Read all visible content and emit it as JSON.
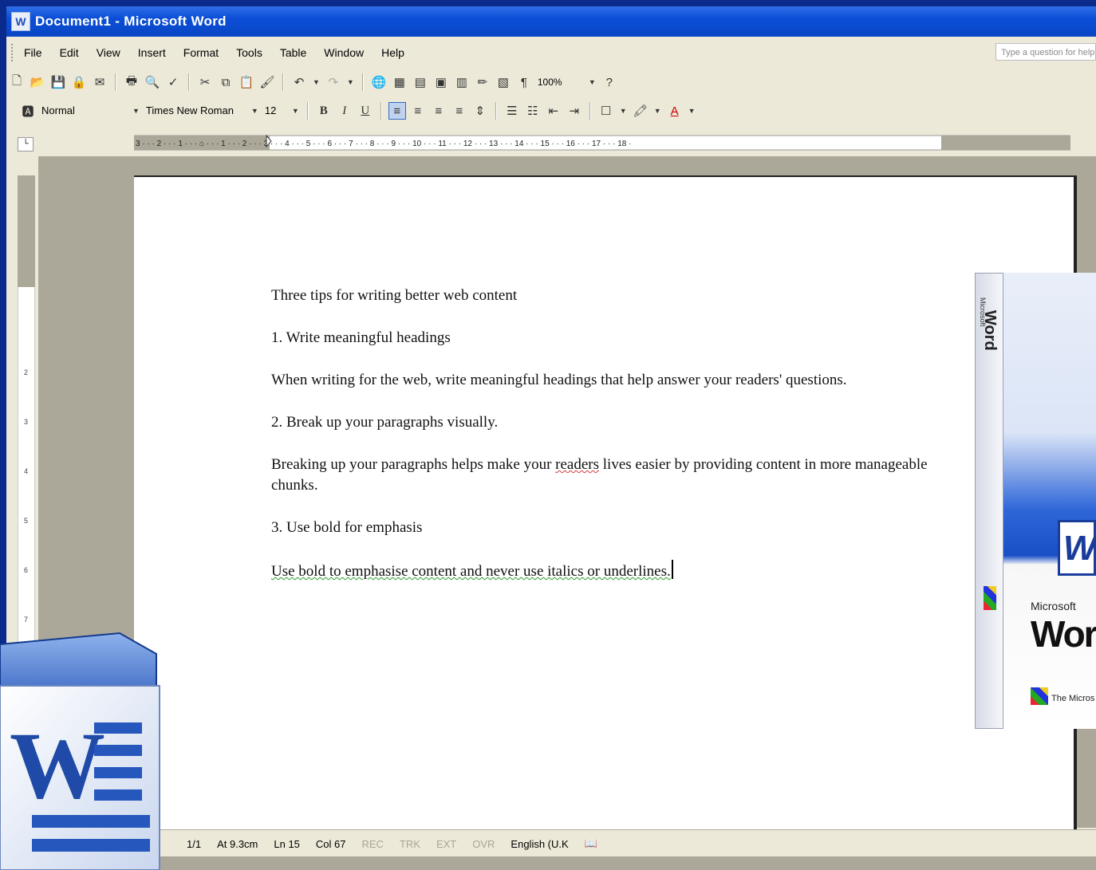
{
  "window": {
    "title": "Document1 - Microsoft Word"
  },
  "menubar": {
    "items": [
      "File",
      "Edit",
      "View",
      "Insert",
      "Format",
      "Tools",
      "Table",
      "Window",
      "Help"
    ],
    "help_placeholder": "Type a question for help"
  },
  "standard_toolbar": {
    "zoom": "100%"
  },
  "formatting_toolbar": {
    "style": "Normal",
    "font": "Times New Roman",
    "size": "12"
  },
  "ruler": {
    "labels": "3 · · · 2 · · · 1 · · · ⌂ · · · 1 · · · 2 · · · 3 · · · 4 · · · 5 · · · 6 · · · 7 · · · 8 · · · 9 · · · 10 · · · 11 · · · 12 · · · 13 · · · 14 · · · 15 · · · 16 · · · 17 · · · 18 ·"
  },
  "document": {
    "paragraphs": [
      "Three tips for writing better web content",
      "1. Write meaningful headings",
      "When writing for the web, write meaningful headings that help answer your readers' questions.",
      "2. Break up your paragraphs visually.",
      "3. Use bold for emphasis"
    ],
    "para5": {
      "pre": "Breaking up your paragraphs helps make your ",
      "err": "readers",
      "post": " lives easier by providing content in more manageable chunks."
    },
    "last": "Use bold to emphasise content and never use italics or underlines."
  },
  "statusbar": {
    "page": "1/1",
    "at": "At 9.3cm",
    "ln": "Ln 15",
    "col": "Col 67",
    "rec": "REC",
    "trk": "TRK",
    "ext": "EXT",
    "ovr": "OVR",
    "language": "English (U.K"
  },
  "product_box": {
    "brand_small": "Microsoft",
    "brand_vertical": "Word",
    "logo_letter": "W",
    "ms": "Microsoft",
    "wor": "Wor",
    "tagline": "The Micros"
  },
  "icon": {
    "name": "word-2007-icon",
    "letter": "W"
  }
}
